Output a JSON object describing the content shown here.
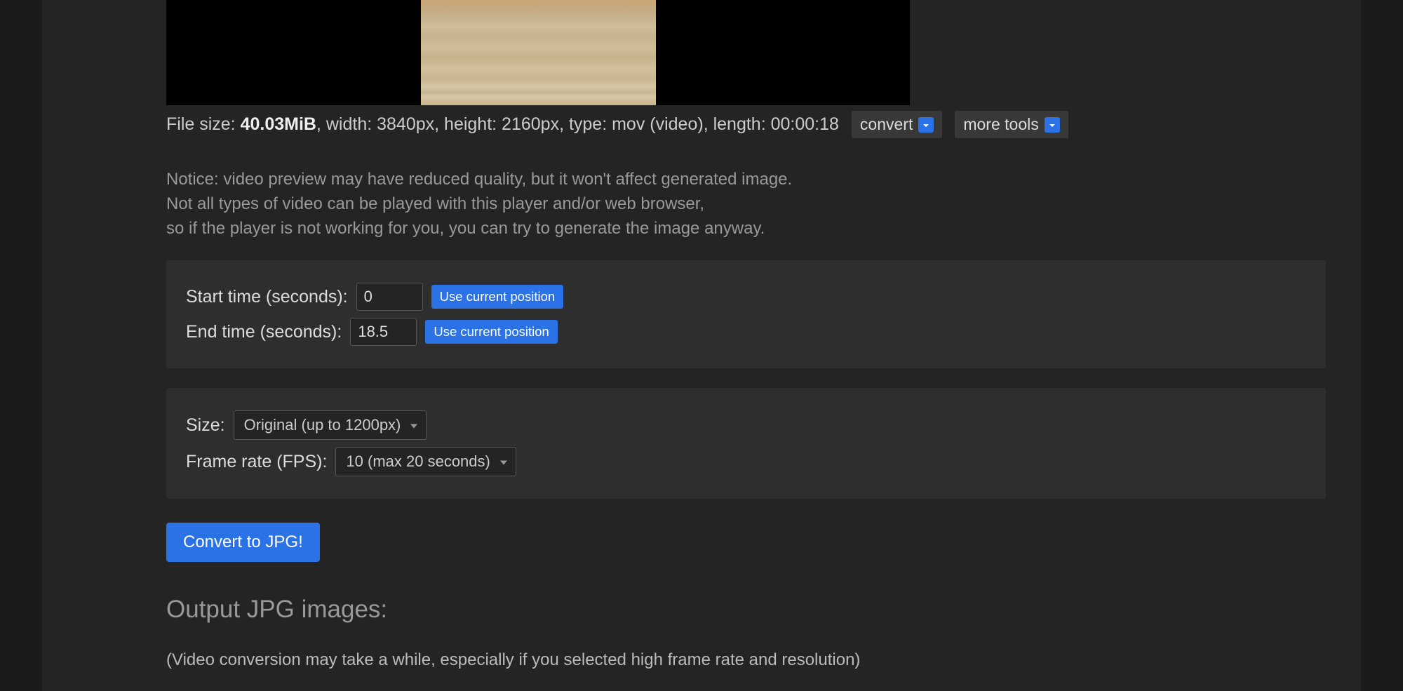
{
  "file_info": {
    "prefix": "File size: ",
    "size": "40.03MiB",
    "rest": ", width: 3840px, height: 2160px, type: mov (video), length: 00:00:18"
  },
  "buttons": {
    "convert": "convert",
    "more_tools": "more tools",
    "use_current_position": "Use current position",
    "convert_main": "Convert to JPG!"
  },
  "notice": {
    "line1": "Notice: video preview may have reduced quality, but it won't affect generated image.",
    "line2": "Not all types of video can be played with this player and/or web browser,",
    "line3": "so if the player is not working for you, you can try to generate the image anyway."
  },
  "time": {
    "start_label": "Start time (seconds):",
    "start_value": "0",
    "end_label": "End time (seconds):",
    "end_value": "18.5"
  },
  "size": {
    "label": "Size:",
    "value": "Original (up to 1200px)"
  },
  "fps": {
    "label": "Frame rate (FPS):",
    "value": "10 (max 20 seconds)"
  },
  "output": {
    "heading": "Output JPG images:",
    "note": "(Video conversion may take a while, especially if you selected high frame rate and resolution)"
  }
}
